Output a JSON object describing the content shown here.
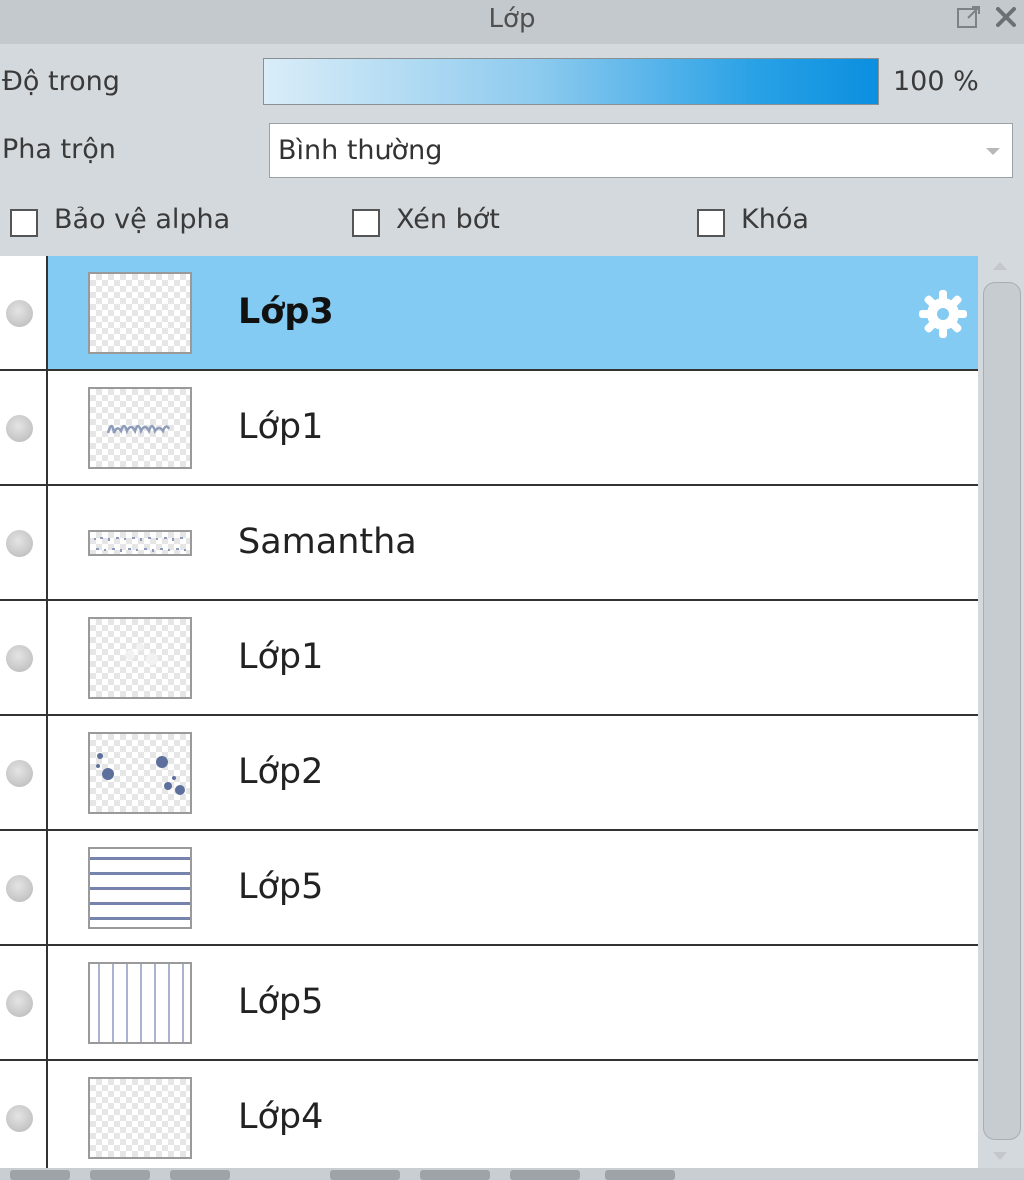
{
  "window": {
    "title": "Lớp"
  },
  "opacity": {
    "label": "Độ trong",
    "value": 100,
    "value_text": "100 %"
  },
  "blend": {
    "label": "Pha trộn",
    "selected": "Bình thường"
  },
  "options": {
    "protect_alpha": {
      "label": "Bảo vệ alpha",
      "checked": false
    },
    "clip": {
      "label": "Xén bớt",
      "checked": false
    },
    "lock": {
      "label": "Khóa",
      "checked": false
    }
  },
  "layers": [
    {
      "name": "Lớp3",
      "selected": true,
      "settings_icon": "gear-icon"
    },
    {
      "name": "Lớp1",
      "selected": false,
      "thumb": "handwriting-sketch"
    },
    {
      "name": "Samantha",
      "selected": false,
      "thumb": "text-strip"
    },
    {
      "name": "Lớp1",
      "selected": false,
      "thumb": "faint-sketch"
    },
    {
      "name": "Lớp2",
      "selected": false,
      "thumb": "dots"
    },
    {
      "name": "Lớp5",
      "selected": false,
      "thumb": "horizontal-stripes"
    },
    {
      "name": "Lớp5",
      "selected": false,
      "thumb": "vertical-stripes"
    },
    {
      "name": "Lớp4",
      "selected": false,
      "thumb": "empty"
    }
  ],
  "colors": {
    "selected_row": "#83cbf2",
    "opacity_bar": "#0b8fdf",
    "panel_bg": "#d4d9de"
  },
  "icons": {
    "popout": "popout-icon",
    "close": "close-icon",
    "visibility": "visibility-dot-icon",
    "settings": "gear-icon"
  }
}
